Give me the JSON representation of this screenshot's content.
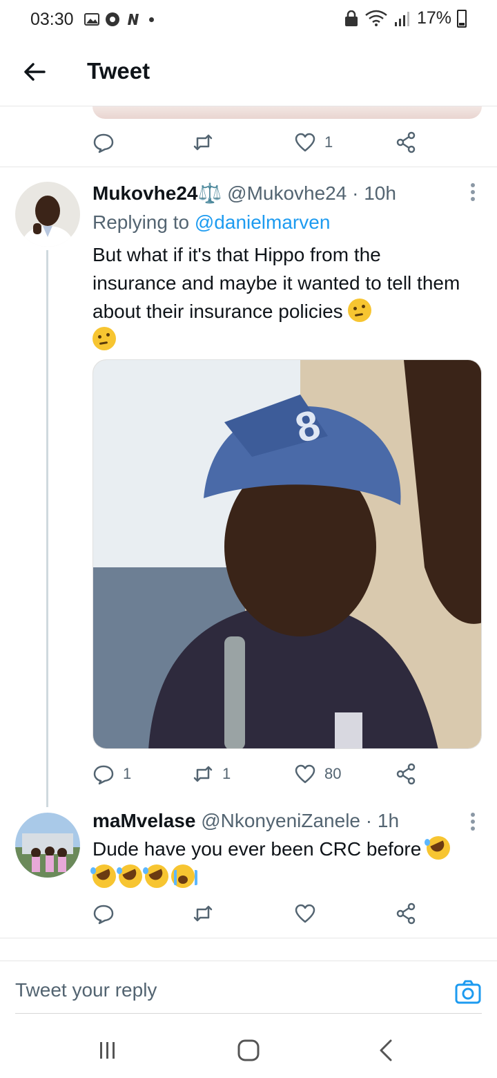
{
  "status_bar": {
    "time": "03:30",
    "battery": "17%",
    "icons_left": [
      "gallery-icon",
      "chrome-icon",
      "n-app-icon"
    ],
    "icons_right": [
      "lock-icon",
      "wifi-icon",
      "signal-icon",
      "battery-icon"
    ]
  },
  "header": {
    "title": "Tweet"
  },
  "previous_tweet_actions": {
    "reply": "",
    "retweet": "",
    "like": "1"
  },
  "tweets": [
    {
      "name": "Mukovhe24⚖️",
      "handle": "@Mukovhe24",
      "time": "· 10h",
      "reply_prefix": "Replying to",
      "reply_mention": "@danielmarven",
      "text": "But what if it's that Hippo from the insurance and maybe it wanted to tell them about their insurance policies",
      "emoji": [
        "thinking-face",
        "thinking-face"
      ],
      "actions": {
        "reply": "1",
        "retweet": "1",
        "like": "80"
      }
    },
    {
      "name": "maMvelase",
      "handle": "@NkonyeniZanele",
      "time": "· 1h",
      "text": "Dude have you ever been CRC before",
      "emoji": [
        "rofl",
        "rofl",
        "rofl",
        "rofl",
        "loudly-crying-face"
      ],
      "actions": {
        "reply": "",
        "retweet": "",
        "like": ""
      }
    }
  ],
  "composer": {
    "placeholder": "Tweet your reply"
  },
  "colors": {
    "accent": "#1d9bf0",
    "secondary_text": "#536471",
    "text": "#0f1419"
  }
}
